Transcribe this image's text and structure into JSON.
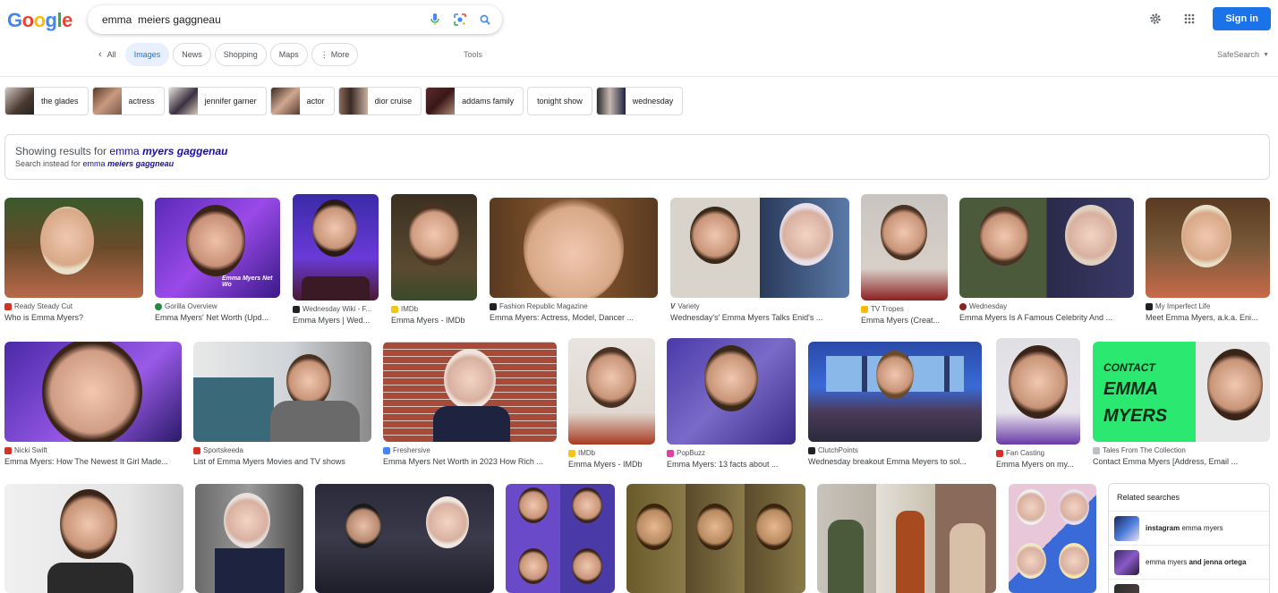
{
  "logo": {
    "g1": "G",
    "o1": "o",
    "o2": "o",
    "g2": "g",
    "l": "l",
    "e": "e"
  },
  "search": {
    "query": "emma  meiers gaggneau"
  },
  "header": {
    "signin": "Sign in"
  },
  "tabs": [
    {
      "label": "All"
    },
    {
      "label": "Images"
    },
    {
      "label": "News"
    },
    {
      "label": "Shopping"
    },
    {
      "label": "Maps"
    },
    {
      "label": "More"
    }
  ],
  "tools": "Tools",
  "safesearch": "SafeSearch",
  "chips": [
    {
      "label": "the glades"
    },
    {
      "label": "actress"
    },
    {
      "label": "jennifer garner"
    },
    {
      "label": "actor"
    },
    {
      "label": "dior cruise"
    },
    {
      "label": "addams family"
    },
    {
      "label": "tonight show"
    },
    {
      "label": "wednesday"
    }
  ],
  "spell": {
    "showing": "Showing results for ",
    "corrected_a": "emma ",
    "corrected_b": "myers gaggenau",
    "instead": "Search instead for ",
    "original_a": "emma ",
    "original_b": "meiers gaggneau"
  },
  "results": [
    {
      "source": "Ready Steady Cut",
      "title": "Who is Emma Myers?"
    },
    {
      "source": "Gorilla Overview",
      "title": "Emma Myers' Net Worth (Upd..."
    },
    {
      "source": "Wednesday Wiki - F...",
      "title": "Emma Myers | Wed..."
    },
    {
      "source": "IMDb",
      "title": "Emma Myers - IMDb"
    },
    {
      "source": "Fashion Republic Magazine",
      "title": "Emma Myers: Actress, Model, Dancer ..."
    },
    {
      "source": "Variety",
      "title": "Wednesday's' Emma Myers Talks Enid's ..."
    },
    {
      "source": "TV Tropes",
      "title": "Emma Myers (Creat..."
    },
    {
      "source": "Wednesday",
      "title": "Emma Myers Is A Famous Celebrity And ..."
    },
    {
      "source": "My Imperfect Life",
      "title": "Meet Emma Myers, a.k.a. Eni..."
    },
    {
      "source": "Nicki Swift",
      "title": "Emma Myers: How The Newest It Girl Made..."
    },
    {
      "source": "Sportskeeda",
      "title": "List of Emma Myers Movies and TV shows"
    },
    {
      "source": "Freshersive",
      "title": "Emma Myers Net Worth in 2023 How Rich ..."
    },
    {
      "source": "IMDb",
      "title": "Emma Myers - IMDb"
    },
    {
      "source": "PopBuzz",
      "title": "Emma Myers: 13 facts about ..."
    },
    {
      "source": "ClutchPoints",
      "title": "Wednesday breakout Emma Meyers to sol..."
    },
    {
      "source": "Fan Casting",
      "title": "Emma Myers on my..."
    },
    {
      "source": "Tales From The Collection",
      "title": "Contact Emma Myers [Address, Email ..."
    }
  ],
  "image_texts": {
    "gorilla_watermark": "Emma Myers Net Wo",
    "contact": "CONTACT",
    "emma": "EMMA",
    "myers": "MYERS"
  },
  "related": {
    "heading": "Related searches",
    "items": [
      {
        "bold": "instagram",
        "rest": " emma myers"
      },
      {
        "pre": "emma myers ",
        "bold": "and jenna ortega"
      }
    ]
  }
}
